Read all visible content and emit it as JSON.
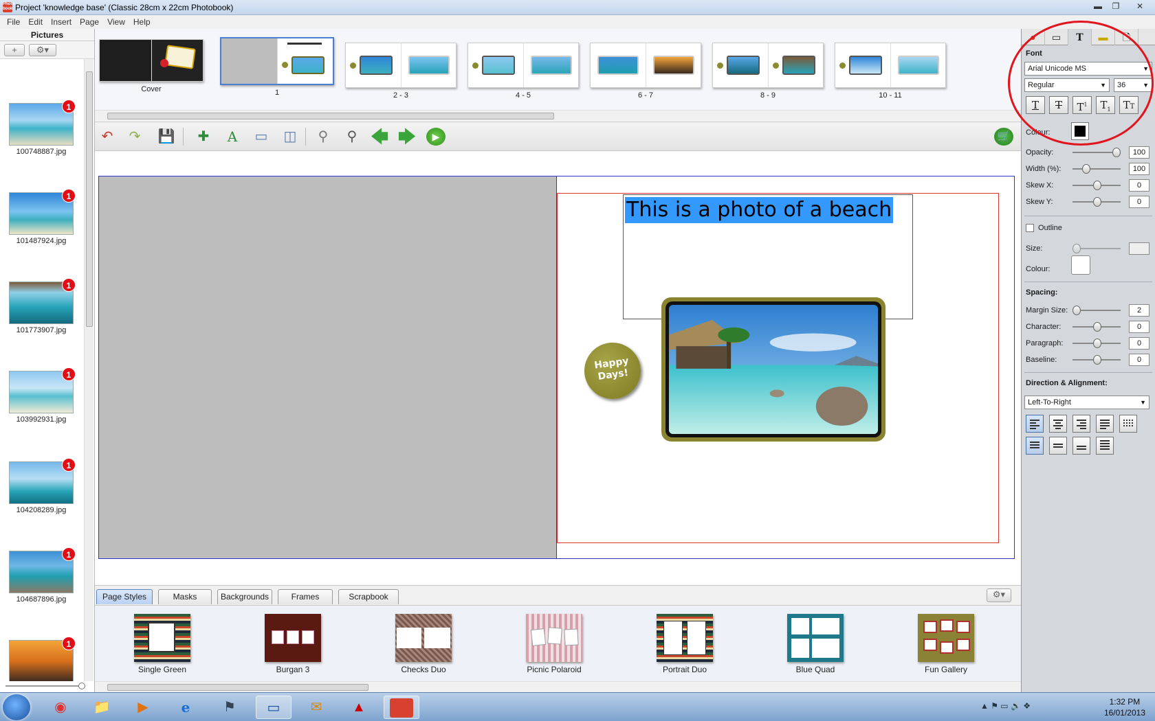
{
  "window": {
    "title": "Project 'knowledge base' (Classic 28cm x 22cm Photobook)",
    "app_icon_text": "Photo book",
    "controls": [
      "minimize",
      "restore",
      "close"
    ]
  },
  "menu": [
    "File",
    "Edit",
    "Insert",
    "Page",
    "View",
    "Help"
  ],
  "pictures_panel": {
    "title": "Pictures",
    "add_label": "+",
    "items": [
      {
        "name": "100748887.jpg",
        "badge": "1"
      },
      {
        "name": "101487924.jpg",
        "badge": "1"
      },
      {
        "name": "101773907.jpg",
        "badge": "1"
      },
      {
        "name": "103992931.jpg",
        "badge": "1"
      },
      {
        "name": "104208289.jpg",
        "badge": "1"
      },
      {
        "name": "104687896.jpg",
        "badge": "1"
      },
      {
        "name": "",
        "badge": "1"
      }
    ]
  },
  "page_strip": {
    "pages": [
      "Cover",
      "1",
      "2 - 3",
      "4 - 5",
      "6 - 7",
      "8 - 9",
      "10 - 11"
    ],
    "selected": "1"
  },
  "canvas": {
    "text_box": "This is a photo of a beach",
    "badge_text_line1": "Happy",
    "badge_text_line2": "Days!"
  },
  "bottom_tabs": [
    "Page Styles",
    "Masks",
    "Backgrounds",
    "Frames",
    "Scrapbook"
  ],
  "active_tab": "Page Styles",
  "styles": [
    "Single Green",
    "Burgan 3",
    "Checks Duo",
    "Picnic Polaroid",
    "Portrait Duo",
    "Blue Quad",
    "Fun Gallery"
  ],
  "properties": {
    "font_label": "Font",
    "font_family": "Arial Unicode MS",
    "font_style": "Regular",
    "font_size": "36",
    "colour_label": "Colour:",
    "text_colour": "#000000",
    "opacity_label": "Opacity:",
    "opacity": "100",
    "width_label": "Width (%):",
    "width": "100",
    "skew_x_label": "Skew X:",
    "skew_x": "0",
    "skew_y_label": "Skew Y:",
    "skew_y": "0",
    "outline_label": "Outline",
    "outline_size_label": "Size:",
    "outline_colour_label": "Colour:",
    "spacing_title": "Spacing:",
    "margin_size_label": "Margin Size:",
    "margin_size": "2",
    "character_label": "Character:",
    "character": "0",
    "paragraph_label": "Paragraph:",
    "paragraph": "0",
    "baseline_label": "Baseline:",
    "baseline": "0",
    "direction_title": "Direction & Alignment:",
    "direction": "Left-To-Right"
  },
  "taskbar": {
    "time": "1:32 PM",
    "date": "16/01/2013"
  },
  "colors": {
    "selection": "#3399ff",
    "annotation": "#e0151d",
    "badge": "#e30d16"
  }
}
